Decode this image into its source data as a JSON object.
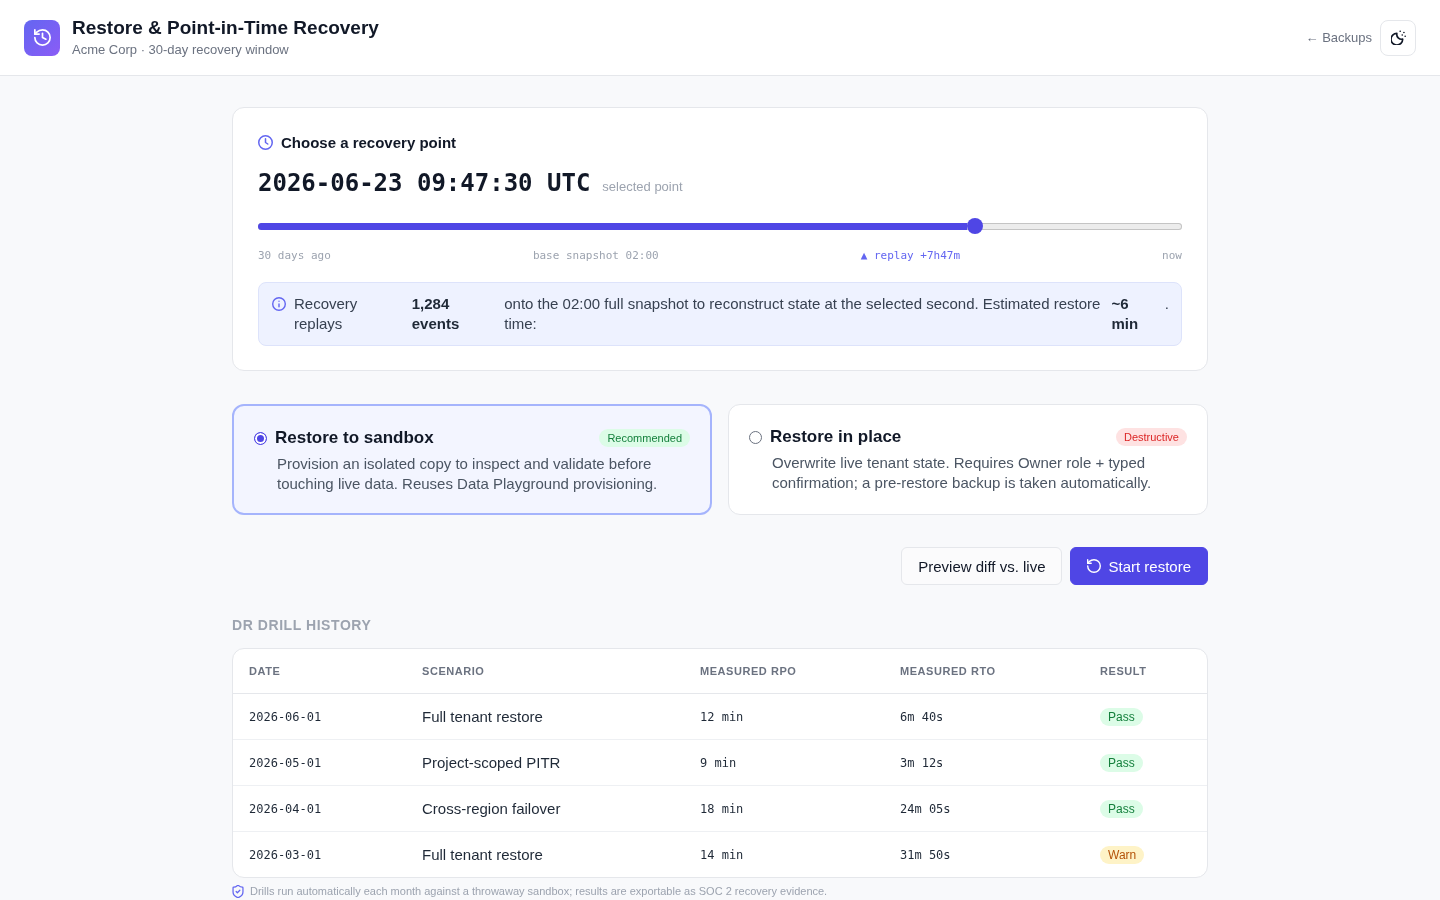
{
  "header": {
    "title": "Restore & Point-in-Time Recovery",
    "subtitle": "Acme Corp · 30-day recovery window",
    "back_link": "← Backups"
  },
  "recovery_point": {
    "title": "Choose a recovery point",
    "timestamp": "2026-06-23 09:47:30 UTC",
    "caption": "selected point",
    "level": 0.776,
    "marks": [
      {
        "label": "30 days ago",
        "kind": "plain"
      },
      {
        "label": "base snapshot 02:00",
        "kind": "plain"
      },
      {
        "label": "▲ replay +7h47m",
        "kind": "accent"
      },
      {
        "label": "now",
        "kind": "plain"
      }
    ],
    "note": [
      {
        "text": "Recovery replays",
        "kind": "plain"
      },
      {
        "text": "1,284 events",
        "kind": "strong"
      },
      {
        "text": "onto the 02:00 full snapshot to reconstruct state at the selected second. Estimated restore time:",
        "kind": "plain"
      },
      {
        "text": "~6 min",
        "kind": "strong"
      },
      {
        "text": ".",
        "kind": "plain"
      }
    ]
  },
  "options": [
    {
      "title": "Restore to sandbox",
      "badge": {
        "label": "Recommended",
        "kind": "positive"
      },
      "description": "Provision an isolated copy to inspect and validate before touching live data. Reuses Data Playground provisioning.",
      "selected": true
    },
    {
      "title": "Restore in place",
      "badge": {
        "label": "Destructive",
        "kind": "danger"
      },
      "description": "Overwrite live tenant state. Requires Owner role + typed confirmation; a pre-restore backup is taken automatically.",
      "selected": false
    }
  ],
  "actions": [
    {
      "label": "Preview diff vs. live",
      "kind": "secondary"
    },
    {
      "label": "Start restore",
      "kind": "primary"
    }
  ],
  "drill_history": {
    "heading": "DR DRILL HISTORY",
    "columns": [
      "DATE",
      "SCENARIO",
      "MEASURED RPO",
      "MEASURED RTO",
      "RESULT"
    ],
    "rows": [
      {
        "date": "2026-06-01",
        "scenario": "Full tenant restore",
        "rpo": "12 min",
        "rto": "6m 40s",
        "result": {
          "label": "Pass",
          "kind": "pass"
        }
      },
      {
        "date": "2026-05-01",
        "scenario": "Project-scoped PITR",
        "rpo": "9 min",
        "rto": "3m 12s",
        "result": {
          "label": "Pass",
          "kind": "pass"
        }
      },
      {
        "date": "2026-04-01",
        "scenario": "Cross-region failover",
        "rpo": "18 min",
        "rto": "24m 05s",
        "result": {
          "label": "Pass",
          "kind": "pass"
        }
      },
      {
        "date": "2026-03-01",
        "scenario": "Full tenant restore",
        "rpo": "14 min",
        "rto": "31m 50s",
        "result": {
          "label": "Warn",
          "kind": "warn"
        }
      }
    ]
  },
  "footer_note": "Drills run automatically each month against a throwaway sandbox; results are exportable as SOC 2 recovery evidence."
}
